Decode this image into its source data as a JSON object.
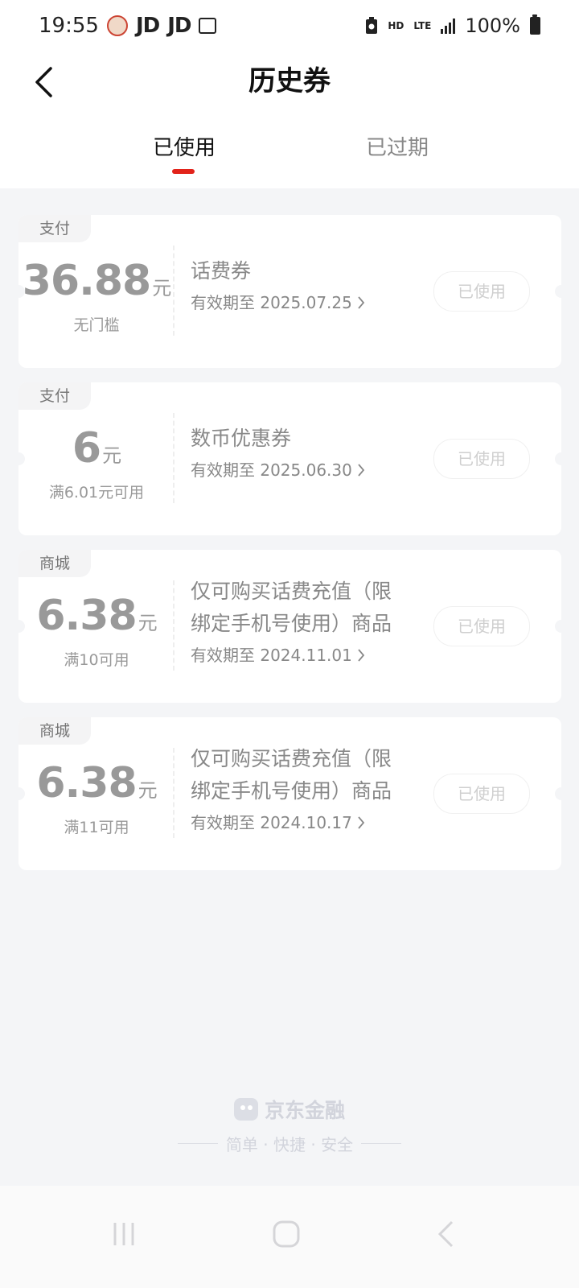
{
  "status_bar": {
    "time": "19:55",
    "notif_app_1": "JD",
    "notif_app_2": "JD",
    "hd": "HD",
    "lte": "LTE",
    "battery": "100%"
  },
  "header": {
    "title": "历史券",
    "tabs": [
      {
        "label": "已使用",
        "active": true
      },
      {
        "label": "已过期",
        "active": false
      }
    ]
  },
  "coupons": [
    {
      "tag": "支付",
      "amount": "36.88",
      "unit": "元",
      "condition": "无门槛",
      "title_lines": [
        "话费券"
      ],
      "validity": "有效期至 2025.07.25",
      "status": "已使用"
    },
    {
      "tag": "支付",
      "amount": "6",
      "unit": "元",
      "condition": "满6.01元可用",
      "title_lines": [
        "数币优惠券"
      ],
      "validity": "有效期至 2025.06.30",
      "status": "已使用"
    },
    {
      "tag": "商城",
      "amount": "6.38",
      "unit": "元",
      "condition": "满10可用",
      "title_lines": [
        "仅可购买话费充值（限",
        "绑定手机号使用）商品"
      ],
      "validity": "有效期至 2024.11.01",
      "status": "已使用"
    },
    {
      "tag": "商城",
      "amount": "6.38",
      "unit": "元",
      "condition": "满11可用",
      "title_lines": [
        "仅可购买话费充值（限",
        "绑定手机号使用）商品"
      ],
      "validity": "有效期至 2024.10.17",
      "status": "已使用"
    }
  ],
  "footer": {
    "brand": "京东金融",
    "slogan": "简单 · 快捷 · 安全"
  },
  "colors": {
    "accent": "#e2231a",
    "background": "#f4f5f7",
    "card": "#ffffff",
    "muted_text": "#999999"
  }
}
